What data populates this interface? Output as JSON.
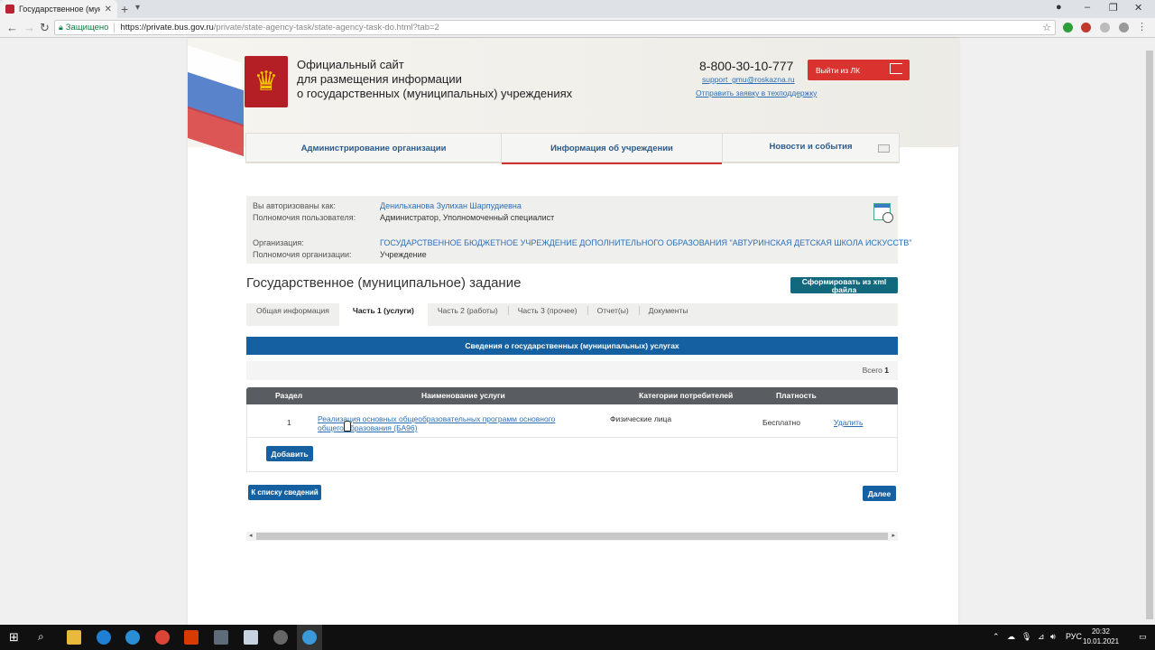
{
  "browser": {
    "tab_title": "Государственное (муни",
    "secure_label": "Защищено",
    "url_host": "https://private.bus.gov.ru",
    "url_path": "/private/state-agency-task/state-agency-task-do.html?tab=2"
  },
  "header": {
    "site_title_1": "Официальный сайт",
    "site_title_2": "для размещения информации",
    "site_title_3": "о государственных (муниципальных) учреждениях",
    "phone": "8-800-30-10-777",
    "support_email": "support_gmu@roskazna.ru",
    "support_link": "Отправить заявку в техподдержку",
    "logout": "Выйти из ЛК"
  },
  "topnav": {
    "items": [
      {
        "label": "Администрирование организации"
      },
      {
        "label": "Информация об учреждении"
      },
      {
        "label": "Новости и события"
      }
    ]
  },
  "auth": {
    "user_label": "Вы авторизованы как:",
    "user_value": "Денильханова Зулихан Шарпудиевна",
    "rights_label": "Полномочия пользователя:",
    "rights_value": "Администратор, Уполномоченный специалист",
    "org_label": "Организация:",
    "org_value": "ГОСУДАРСТВЕННОЕ БЮДЖЕТНОЕ УЧРЕЖДЕНИЕ ДОПОЛНИТЕЛЬНОГО ОБРАЗОВАНИЯ \"АВТУРИНСКАЯ ДЕТСКАЯ ШКОЛА ИСКУССТВ\"",
    "org_rights_label": "Полномочия организации:",
    "org_rights_value": "Учреждение"
  },
  "main": {
    "title": "Государственное (муниципальное) задание",
    "xml_button": "Сформировать из xml файла",
    "tabs": [
      {
        "label": "Общая информация"
      },
      {
        "label": "Часть 1 (услуги)"
      },
      {
        "label": "Часть 2 (работы)"
      },
      {
        "label": "Часть 3 (прочее)"
      },
      {
        "label": "Отчет(ы)"
      },
      {
        "label": "Документы"
      }
    ],
    "section_title": "Сведения о государственных (муниципальных) услугах",
    "total_label": "Всего",
    "total_value": "1",
    "columns": [
      "Раздел",
      "Наименование услуги",
      "Категории потребителей",
      "Платность"
    ],
    "row": {
      "section": "1",
      "service": "Реализация основных общеобразовательных программ основного общего образования (БА96)",
      "consumers": "Физические лица",
      "paid": "Бесплатно",
      "delete": "Удалить"
    },
    "add_button": "Добавить",
    "back_button": "К списку сведений",
    "next_button": "Далее"
  },
  "taskbar": {
    "lang": "РУС",
    "time": "20:32",
    "date": "10.01.2021"
  }
}
